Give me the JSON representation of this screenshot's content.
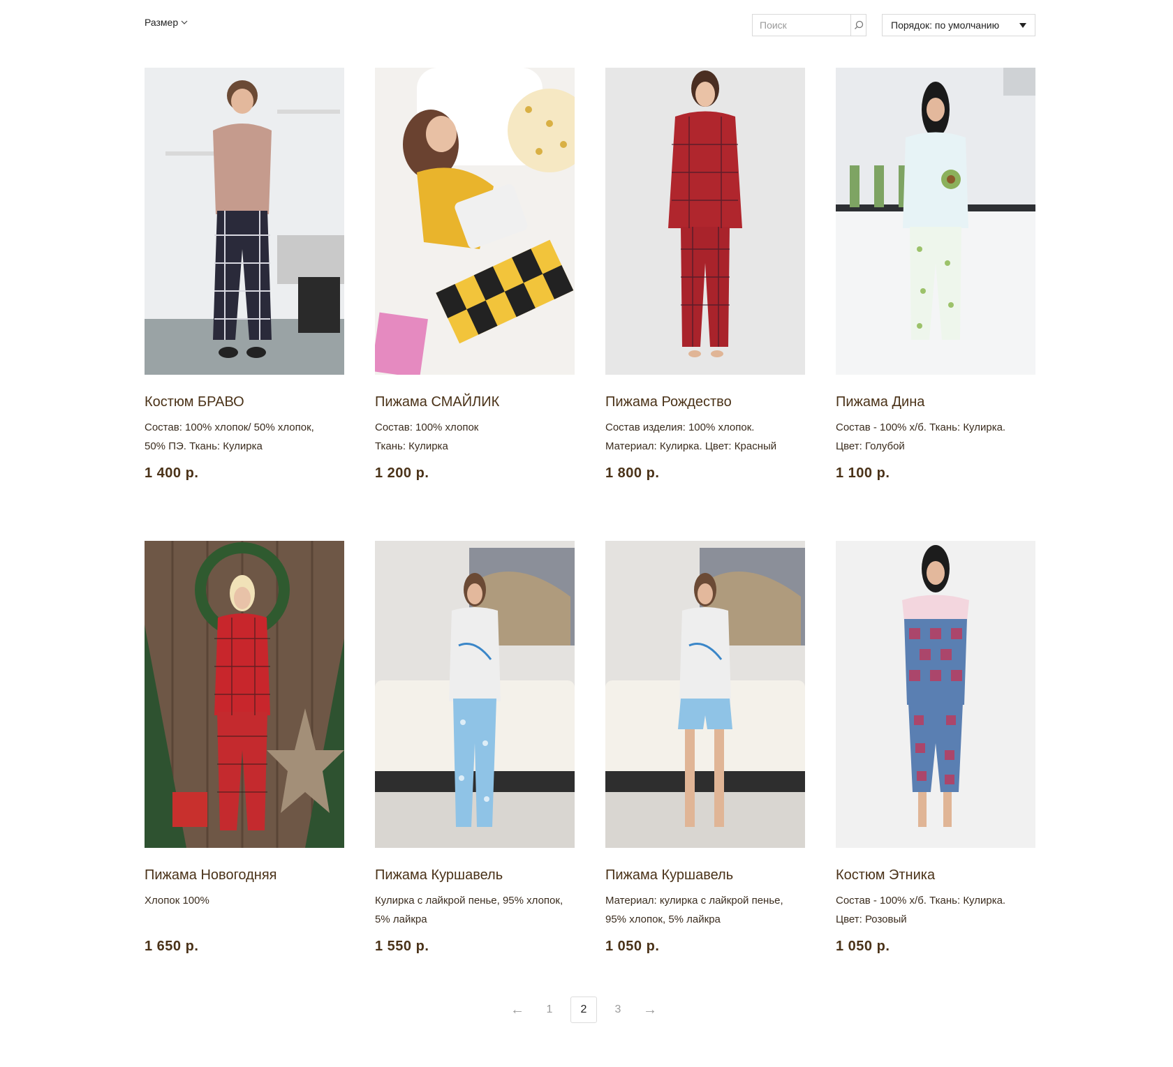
{
  "toolbar": {
    "size_filter_label": "Размер",
    "search_placeholder": "Поиск",
    "sort_label": "Порядок: по умолчанию"
  },
  "products": [
    {
      "title": "Костюм БРАВО",
      "desc_line1": "Состав: 100% хлопок/ 50% хлопок,",
      "desc_line2": "50% ПЭ. Ткань: Кулирка",
      "price": "1 400 р."
    },
    {
      "title": "Пижама СМАЙЛИК",
      "desc_line1": "Состав: 100% хлопок",
      "desc_line2": "Ткань: Кулирка",
      "price": "1 200 р."
    },
    {
      "title": "Пижама Рождество",
      "desc_line1": "Состав изделия: 100% хлопок.",
      "desc_line2": "Материал: Кулирка. Цвет: Красный",
      "price": "1 800 р."
    },
    {
      "title": "Пижама Дина",
      "desc_line1": "Состав - 100% х/б. Ткань: Кулирка.",
      "desc_line2": "Цвет: Голубой",
      "price": "1 100 р."
    },
    {
      "title": "Пижама Новогодняя",
      "desc_line1": "Хлопок 100%",
      "desc_line2": "",
      "price": "1 650 р."
    },
    {
      "title": "Пижама Куршавель",
      "desc_line1": "Кулирка с лайкрой пенье, 95% хлопок,",
      "desc_line2": "5% лайкра",
      "price": "1 550 р."
    },
    {
      "title": "Пижама Куршавель",
      "desc_line1": "Материал: кулирка с лайкрой пенье,",
      "desc_line2": "95% хлопок, 5% лайкра",
      "price": "1 050 р."
    },
    {
      "title": "Костюм Этника",
      "desc_line1": "Состав - 100% х/б. Ткань: Кулирка.",
      "desc_line2": "Цвет: Розовый",
      "price": "1 050 р."
    }
  ],
  "pagination": {
    "prev": "←",
    "pages": [
      "1",
      "2",
      "3"
    ],
    "current": "2",
    "next": "→"
  }
}
